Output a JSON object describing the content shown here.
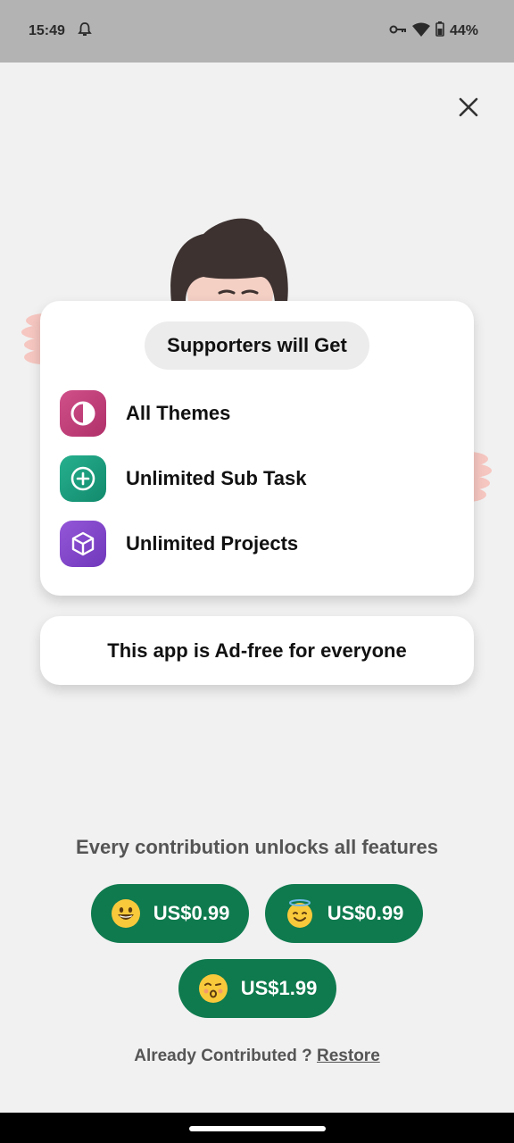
{
  "status_bar": {
    "time": "15:49",
    "battery": "44%",
    "icons": [
      "alarm-icon",
      "vpn-key-icon",
      "wifi-icon",
      "battery-icon"
    ]
  },
  "close_icon": "close-icon",
  "benefits_card": {
    "title": "Supporters will Get",
    "features": [
      {
        "label": "All Themes",
        "icon": "theme-icon",
        "color": "#c2407a"
      },
      {
        "label": "Unlimited Sub Task",
        "icon": "plus-circle-icon",
        "color": "#1c9b7e"
      },
      {
        "label": "Unlimited Projects",
        "icon": "cube-icon",
        "color": "#8044c8"
      }
    ]
  },
  "adfree_notice": "This app is Ad-free for everyone",
  "contribution_text": "Every contribution unlocks all features",
  "prices": [
    {
      "label": "US$0.99",
      "emoji": "grinning-face-icon"
    },
    {
      "label": "US$0.99",
      "emoji": "halo-face-icon"
    },
    {
      "label": "US$1.99",
      "emoji": "kissing-face-icon"
    }
  ],
  "restore": {
    "prefix": "Already Contributed ?",
    "link": "Restore"
  },
  "colors": {
    "accent": "#0f7a4e",
    "background": "#f1f1f1",
    "status_bar": "#b3b3b3"
  }
}
